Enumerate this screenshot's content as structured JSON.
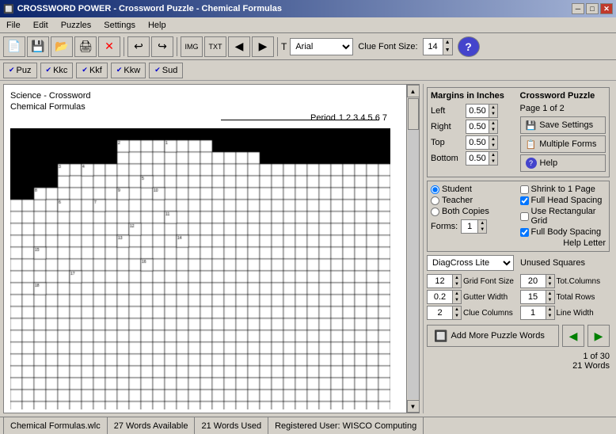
{
  "titleBar": {
    "icon": "🔲",
    "title": "CROSSWORD POWER - Crossword Puzzle - Chemical Formulas",
    "minBtn": "─",
    "maxBtn": "□",
    "closeBtn": "✕"
  },
  "menuBar": {
    "items": [
      "File",
      "Edit",
      "Puzzles",
      "Settings",
      "Help"
    ]
  },
  "toolbar": {
    "font": "Arial",
    "clueFontLabel": "Clue Font Size:",
    "clueFontSize": "14",
    "helpIcon": "?"
  },
  "formatBar": {
    "tabs": [
      "Puz",
      "Kkc",
      "Kkf",
      "Kkw",
      "Sud"
    ]
  },
  "puzzle": {
    "title1": "Science - Crossword",
    "title2": "Chemical Formulas",
    "periodLabel": "Period",
    "periods": "1  2  3  4  5  6  7"
  },
  "margins": {
    "title": "Margins in Inches",
    "left": {
      "label": "Left",
      "value": "0.50"
    },
    "right": {
      "label": "Right",
      "value": "0.50"
    },
    "top": {
      "label": "Top",
      "value": "0.50"
    },
    "bottom": {
      "label": "Bottom",
      "value": "0.50"
    }
  },
  "crosswordInfo": {
    "title": "Crossword Puzzle",
    "page": "Page 1 of 2",
    "saveLabel": "Save Settings",
    "multipleLabel": "Multiple Forms",
    "helpLabel": "Help"
  },
  "options": {
    "radioItems": [
      "Student",
      "Teacher",
      "Both Copies"
    ],
    "formsLabel": "Forms:",
    "formsValue": "1",
    "checkItems": [
      "Shrink to 1 Page",
      "Full Head Spacing",
      "Use Rectangular Grid",
      "Full Body Spacing"
    ],
    "checkStates": [
      false,
      true,
      false,
      true
    ],
    "helpLetterLabel": "Help Letter"
  },
  "diagcross": {
    "selectValue": "DiagCross Lite",
    "unusedLabel": "Unused Squares"
  },
  "numeric": {
    "gridFontSize": {
      "label": "Grid Font Size",
      "value": "12"
    },
    "gutterWidth": {
      "label": "Gutter Width",
      "value": "0.2"
    },
    "clueColumns": {
      "label": "Clue Columns",
      "value": "2"
    },
    "totColumns": {
      "label": "Tot.Columns",
      "value": "20"
    },
    "totalRows": {
      "label": "Total Rows",
      "value": "15"
    },
    "lineWidth": {
      "label": "Line Width",
      "value": "1"
    }
  },
  "addWords": {
    "label": "Add More Puzzle Words"
  },
  "statusInfo": {
    "line1": "1 of 30",
    "line2": "21 Words"
  },
  "statusBar": {
    "file": "Chemical Formulas.wlc",
    "wordsAvailable": "27 Words Available",
    "wordsUsed": "21 Words Used",
    "user": "Registered User: WISCO Computing"
  }
}
